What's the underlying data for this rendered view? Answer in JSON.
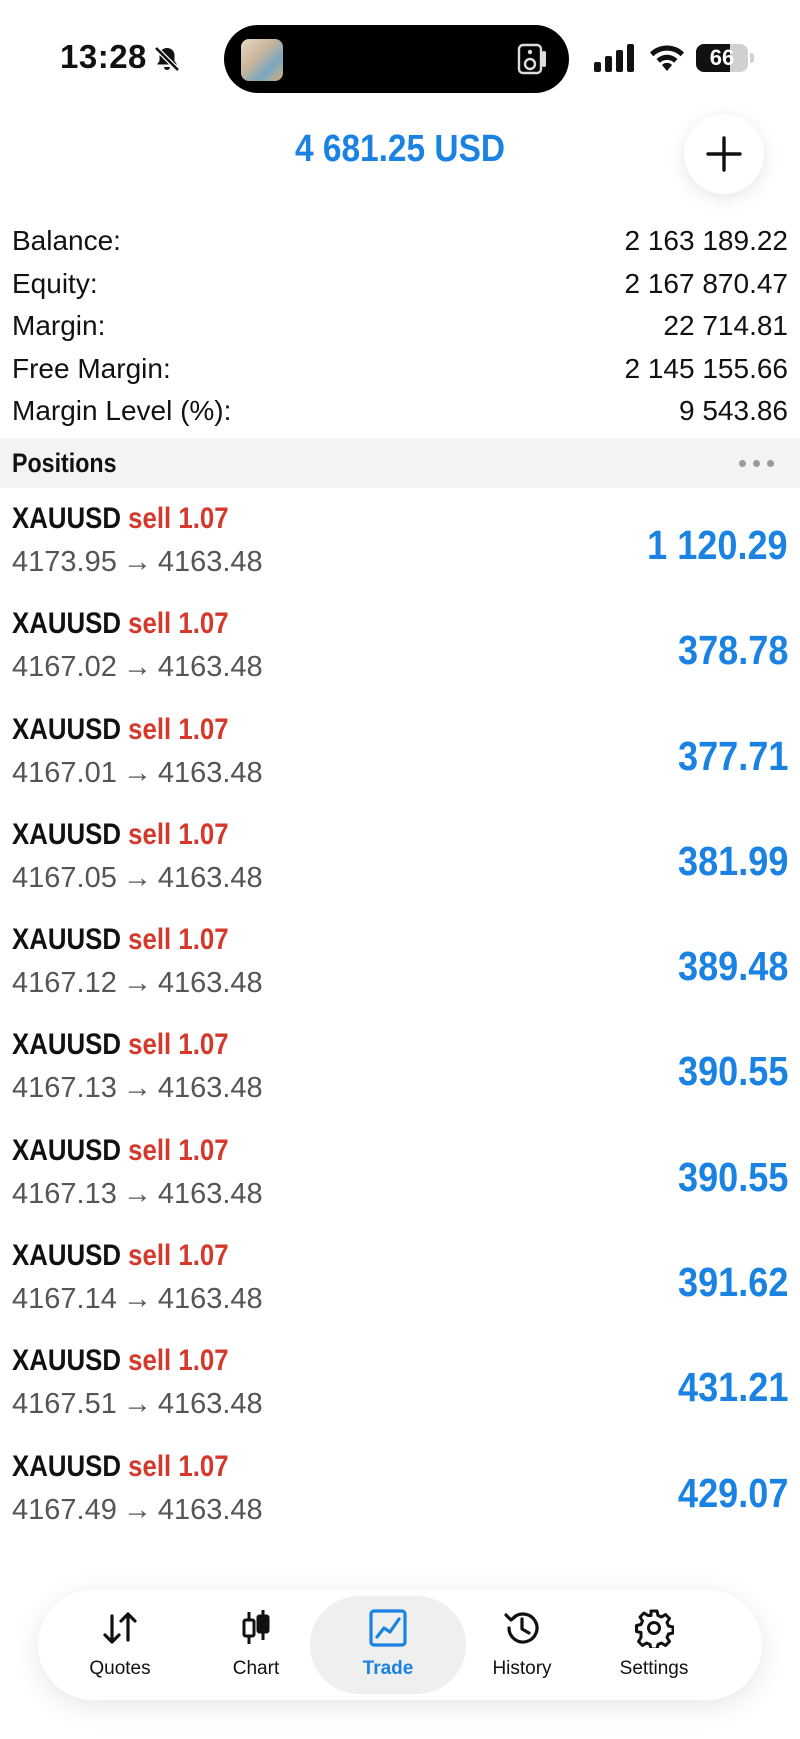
{
  "status_bar": {
    "time": "13:28",
    "battery_level": "66",
    "battery_fraction": 0.66,
    "icons": [
      "bell-slash-icon",
      "cellular-signal-icon",
      "wifi-icon",
      "battery-icon"
    ]
  },
  "header": {
    "total": "4 681.25 USD",
    "add_icon": "plus-icon"
  },
  "summary": [
    {
      "label": "Balance:",
      "value": "2 163 189.22"
    },
    {
      "label": "Equity:",
      "value": "2 167 870.47"
    },
    {
      "label": "Margin:",
      "value": "22 714.81"
    },
    {
      "label": "Free Margin:",
      "value": "2 145 155.66"
    },
    {
      "label": "Margin Level (%):",
      "value": "9 543.86"
    }
  ],
  "positions_header": {
    "title": "Positions",
    "more_icon": "more-dots-icon"
  },
  "positions": [
    {
      "symbol": "XAUUSD",
      "side": "sell",
      "volume": "1.07",
      "open": "4173.95",
      "arrow": "→",
      "current": "4163.48",
      "profit": "1 120.29"
    },
    {
      "symbol": "XAUUSD",
      "side": "sell",
      "volume": "1.07",
      "open": "4167.02",
      "arrow": "→",
      "current": "4163.48",
      "profit": "378.78"
    },
    {
      "symbol": "XAUUSD",
      "side": "sell",
      "volume": "1.07",
      "open": "4167.01",
      "arrow": "→",
      "current": "4163.48",
      "profit": "377.71"
    },
    {
      "symbol": "XAUUSD",
      "side": "sell",
      "volume": "1.07",
      "open": "4167.05",
      "arrow": "→",
      "current": "4163.48",
      "profit": "381.99"
    },
    {
      "symbol": "XAUUSD",
      "side": "sell",
      "volume": "1.07",
      "open": "4167.12",
      "arrow": "→",
      "current": "4163.48",
      "profit": "389.48"
    },
    {
      "symbol": "XAUUSD",
      "side": "sell",
      "volume": "1.07",
      "open": "4167.13",
      "arrow": "→",
      "current": "4163.48",
      "profit": "390.55"
    },
    {
      "symbol": "XAUUSD",
      "side": "sell",
      "volume": "1.07",
      "open": "4167.13",
      "arrow": "→",
      "current": "4163.48",
      "profit": "390.55"
    },
    {
      "symbol": "XAUUSD",
      "side": "sell",
      "volume": "1.07",
      "open": "4167.14",
      "arrow": "→",
      "current": "4163.48",
      "profit": "391.62"
    },
    {
      "symbol": "XAUUSD",
      "side": "sell",
      "volume": "1.07",
      "open": "4167.51",
      "arrow": "→",
      "current": "4163.48",
      "profit": "431.21"
    },
    {
      "symbol": "XAUUSD",
      "side": "sell",
      "volume": "1.07",
      "open": "4167.49",
      "arrow": "→",
      "current": "4163.48",
      "profit": "429.07"
    }
  ],
  "bottom_nav": [
    {
      "label": "Quotes",
      "icon": "quotes-arrows-icon",
      "active": false
    },
    {
      "label": "Chart",
      "icon": "candlestick-chart-icon",
      "active": false
    },
    {
      "label": "Trade",
      "icon": "trade-chart-icon",
      "active": true
    },
    {
      "label": "History",
      "icon": "history-clock-icon",
      "active": false
    },
    {
      "label": "Settings",
      "icon": "settings-gear-icon",
      "active": false
    }
  ],
  "colors": {
    "accent_blue": "#1a82e2",
    "sell_red": "#d4392c",
    "text_dark": "#111111",
    "text_gray": "#555555",
    "section_bg": "#f3f3f5"
  }
}
